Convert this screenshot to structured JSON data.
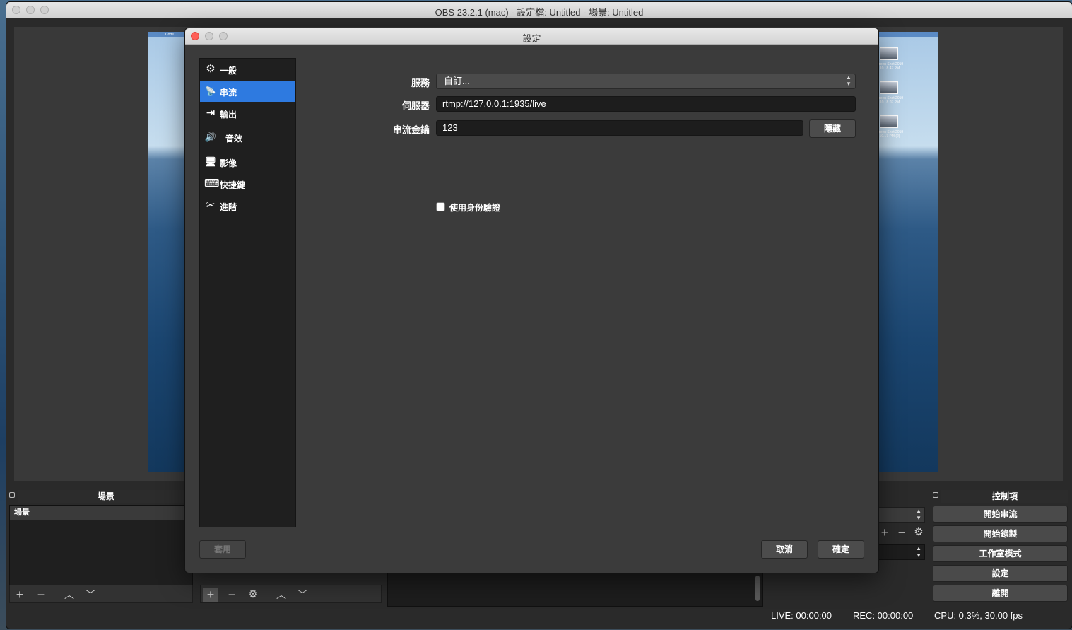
{
  "main_window": {
    "title": "OBS 23.2.1 (mac) - 設定檔: Untitled - 場景: Untitled"
  },
  "preview": {
    "menubar_text": "Code",
    "desktop_files": [
      {
        "label": "Screen Shot 2019-10...8.47 PM"
      },
      {
        "label": "Screen Shot 2019-10...8.07 PM"
      },
      {
        "label": "Screen Shot 2019-10...7 PM (2)"
      }
    ]
  },
  "scenes_dock": {
    "title": "場景",
    "items": [
      "場景"
    ]
  },
  "controls_dock": {
    "title": "控制項",
    "buttons": [
      "開始串流",
      "開始錄製",
      "工作室模式",
      "設定",
      "離開"
    ]
  },
  "status": {
    "live": "LIVE: 00:00:00",
    "rec": "REC: 00:00:00",
    "cpu": "CPU: 0.3%, 30.00 fps"
  },
  "settings": {
    "title": "設定",
    "sidebar": [
      {
        "label": "一般",
        "icon": "gear-icon",
        "glyph": "⚙"
      },
      {
        "label": "串流",
        "icon": "broadcast-icon",
        "glyph": "📡"
      },
      {
        "label": "輸出",
        "icon": "output-icon",
        "glyph": "⇥"
      },
      {
        "label": "音效",
        "icon": "speaker-icon",
        "glyph": "🔊"
      },
      {
        "label": "影像",
        "icon": "monitor-icon",
        "glyph": "🖥"
      },
      {
        "label": "快捷鍵",
        "icon": "keyboard-icon",
        "glyph": "⌨"
      },
      {
        "label": "進階",
        "icon": "tools-icon",
        "glyph": "✂"
      }
    ],
    "active_index": 1,
    "stream": {
      "service_label": "服務",
      "service_value": "自訂...",
      "server_label": "伺服器",
      "server_value": "rtmp://127.0.0.1:1935/live",
      "key_label": "串流金鑰",
      "key_value": "123",
      "hide_button": "隱藏",
      "auth_label": "使用身份驗證",
      "auth_checked": false
    },
    "buttons": {
      "apply": "套用",
      "cancel": "取消",
      "ok": "確定"
    }
  }
}
